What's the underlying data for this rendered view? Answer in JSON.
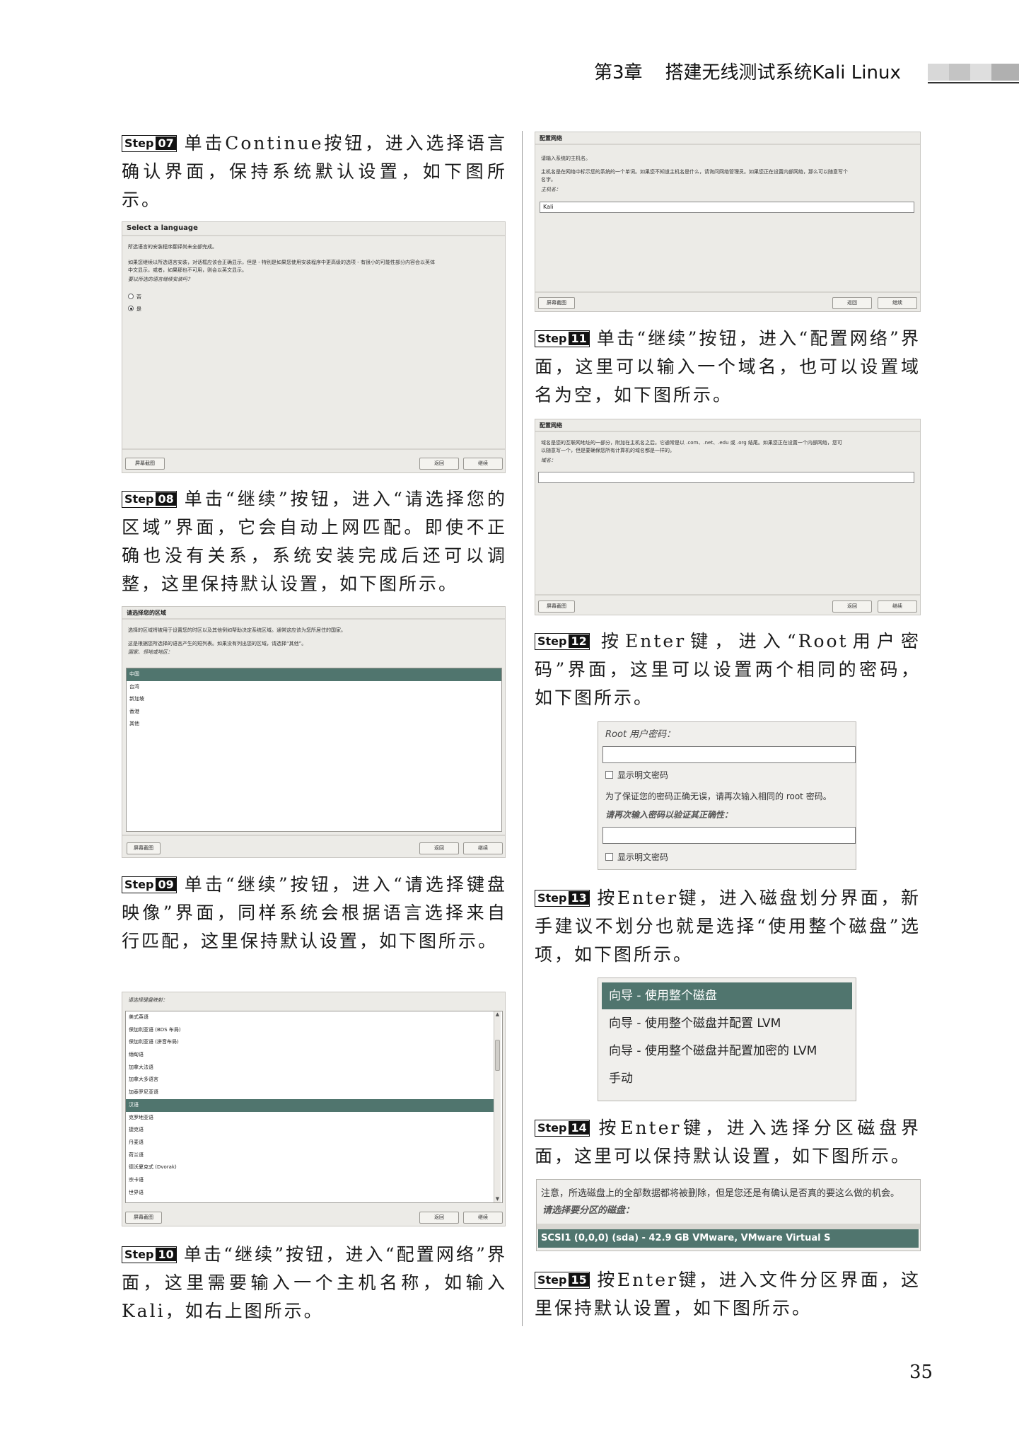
{
  "header": {
    "chapter": "第3章",
    "title": "搭建无线测试系统Kali Linux"
  },
  "page_number": "35",
  "step_word": "Step",
  "steps": {
    "s07": {
      "num": "07",
      "text": "单击Continue按钮，进入选择语言确认界面，保持系统默认设置，如下图所示。"
    },
    "s08": {
      "num": "08",
      "text": "单击“继续”按钮，进入“请选择您的区域”界面，它会自动上网匹配。即使不正确也没有关系，系统安装完成后还可以调整，这里保持默认设置，如下图所示。"
    },
    "s09": {
      "num": "09",
      "text": "单击“继续”按钮，进入“请选择键盘映像”界面，同样系统会根据语言选择来自行匹配，这里保持默认设置，如下图所示。"
    },
    "s10": {
      "num": "10",
      "text": "单击“继续”按钮，进入“配置网络”界面，这里需要输入一个主机名称，如输入Kali，如右上图所示。"
    },
    "s11": {
      "num": "11",
      "text": "单击“继续”按钮，进入“配置网络”界面，这里可以输入一个域名，也可以设置域名为空，如下图所示。"
    },
    "s12": {
      "num": "12",
      "text": "按Enter键，进入“Root用户密码”界面，这里可以设置两个相同的密码，如下图所示。"
    },
    "s13": {
      "num": "13",
      "text": "按Enter键，进入磁盘划分界面，新手建议不划分也就是选择“使用整个磁盘”选项，如下图所示。"
    },
    "s14": {
      "num": "14",
      "text": "按Enter键，进入选择分区磁盘界面，这里可以保持默认设置，如下图所示。"
    },
    "s15": {
      "num": "15",
      "text": "按Enter键，进入文件分区界面，这里保持默认设置，如下图所示。"
    }
  },
  "buttons": {
    "screenshot": "屏幕截图",
    "back": "返回",
    "continue": "继续"
  },
  "shot_language": {
    "title": "Select a language",
    "line1": "所选语言的安装程序翻译尚未全部完成。",
    "line2": "如果您继续以所选语言安装，对话框应该会正确显示，但是 - 特别是如果您使用安装程序中更高级的选项 - 有很小的可能性部分内容会以英体",
    "line3": "中文显示，或者，如果那也不可用，则会以英文显示。",
    "question": "要以所选的语言继续安装吗？",
    "opt_no": "否",
    "opt_yes": "是"
  },
  "shot_region": {
    "title": "请选择您的区域",
    "line1": "选择的区域将被用于设置您的时区以及其他例如帮助决定系统区域。通常这应该为您所居住的国家。",
    "line2": "这是根据您所选择的语言产生的短列表。如果没有列出您的区域，请选择“其他”。",
    "prompt": "国家、领地或地区：",
    "items": [
      "中国",
      "台湾",
      "新加坡",
      "香港",
      "其他"
    ]
  },
  "shot_keyboard": {
    "prompt": "请选择键盘映射：",
    "items": [
      "美式英语",
      "保加利亚语 (BDS 布局)",
      "保加利亚语 (拼音布局)",
      "缅甸语",
      "加拿大法语",
      "加拿大多语言",
      "加泰罗尼亚语",
      "汉语",
      "克罗地亚语",
      "捷克语",
      "丹麦语",
      "荷兰语",
      "德沃夏克式 (Dvorak)",
      "宗卡语",
      "世界语"
    ]
  },
  "shot_hostname": {
    "title": "配置网络",
    "line1": "请输入系统的主机名。",
    "line2": "主机名是在网络中标示您的系统的一个单词。如果您不知道主机名是什么，请询问网络管理员。如果您正在设置内部网络，那么可以随意写个",
    "line3": "名字。",
    "prompt": "主机名：",
    "value": "Kali"
  },
  "shot_domain": {
    "title": "配置网络",
    "line1": "域名是您的互联网地址的一部分，附加在主机名之后。它通常是以 .com、.net、.edu 或 .org 结尾。如果您正在设置一个内部网络，您可",
    "line2": "以随意写一个，但是要确保您所有计算机的域名都是一样的。",
    "prompt": "域名："
  },
  "shot_root": {
    "label": "Root 用户密码：",
    "show1": "显示明文密码",
    "note": "为了保证您的密码正确无误，请再次输入相同的 root 密码。",
    "again": "请再次输入密码以验证其正确性：",
    "show2": "显示明文密码"
  },
  "shot_partition": {
    "items": [
      "向导 - 使用整个磁盘",
      "向导 - 使用整个磁盘并配置 LVM",
      "向导 - 使用整个磁盘并配置加密的 LVM",
      "手动"
    ]
  },
  "shot_disk": {
    "warning": "注意，所选磁盘上的全部数据都将被删除，但是您还是有确认是否真的要这么做的机会。",
    "prompt": "请选择要分区的磁盘：",
    "disk": "SCSI1 (0,0,0) (sda) - 42.9 GB VMware, VMware Virtual S"
  },
  "colors": {
    "selection": "#50756e",
    "dialog_bg": "#ecebe7"
  }
}
